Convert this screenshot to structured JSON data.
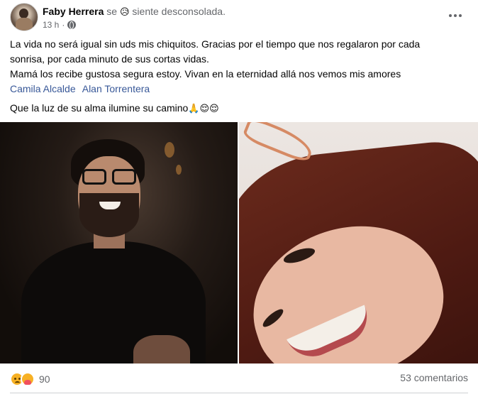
{
  "post": {
    "author_name": "Faby Herrera",
    "feeling_prefix": "se",
    "feeling_emoji": "😥",
    "feeling_text": "siente desconsolada.",
    "timestamp": "13 h",
    "dot": "·",
    "body_line_1": "La vida no será igual sin uds mis chiquitos. Gracias por el tiempo que nos regalaron por  cada",
    "body_line_2": "sonrisa, por cada minuto de sus cortas vidas.",
    "body_line_3": "Mamá los recibe gustosa segura estoy. Vivan en la eternidad allá nos vemos mis amores",
    "tags": [
      "Camila Alcalde",
      "Alan Torrentera"
    ],
    "closing_text": "Que la luz de su alma ilumine su camino",
    "closing_emojis": "🙏😌😌"
  },
  "reactions": {
    "icons": [
      "sad-icon",
      "care-icon"
    ],
    "count": "90",
    "comments": "53 comentarios"
  },
  "colors": {
    "link": "#385898",
    "secondary_text": "#65676b"
  }
}
